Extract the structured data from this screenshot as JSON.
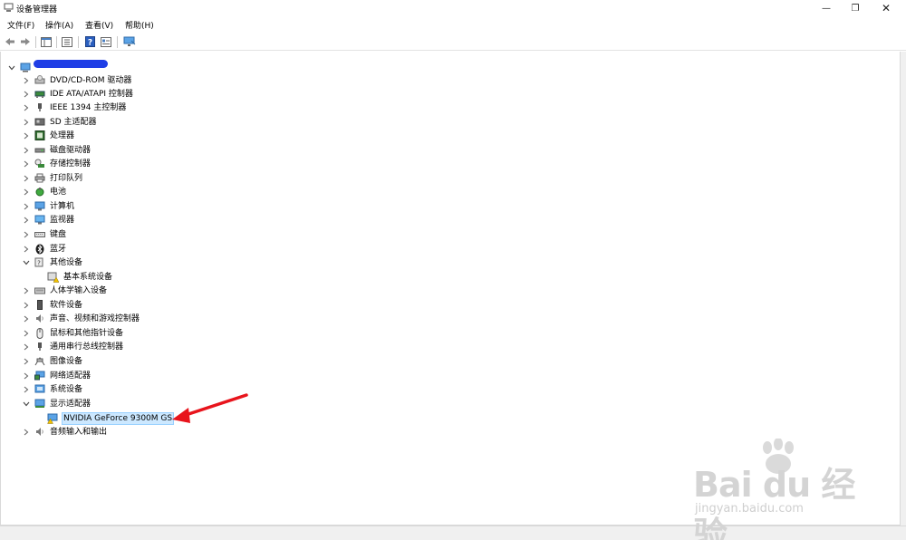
{
  "window": {
    "title": "设备管理器",
    "minimize_glyph": "—",
    "maximize_glyph": "❐",
    "close_glyph": "✕"
  },
  "menu": {
    "items": [
      "文件(F)",
      "操作(A)",
      "查看(V)",
      "帮助(H)"
    ]
  },
  "toolbar": {
    "icons": [
      "back-icon",
      "forward-icon",
      "properties-pane-icon",
      "list-view-icon",
      "help-icon",
      "resources-icon",
      "monitor-icon"
    ]
  },
  "tree": {
    "root_label_redacted": true,
    "nodes": [
      {
        "label": "DVD/CD-ROM 驱动器",
        "icon": "dvd-drive-icon"
      },
      {
        "label": "IDE ATA/ATAPI 控制器",
        "icon": "ide-controller-icon"
      },
      {
        "label": "IEEE 1394 主控制器",
        "icon": "ieee1394-icon"
      },
      {
        "label": "SD 主适配器",
        "icon": "sd-adapter-icon"
      },
      {
        "label": "处理器",
        "icon": "processor-icon"
      },
      {
        "label": "磁盘驱动器",
        "icon": "disk-drive-icon"
      },
      {
        "label": "存储控制器",
        "icon": "storage-controller-icon"
      },
      {
        "label": "打印队列",
        "icon": "printer-icon"
      },
      {
        "label": "电池",
        "icon": "battery-icon"
      },
      {
        "label": "计算机",
        "icon": "computer-icon"
      },
      {
        "label": "监视器",
        "icon": "monitor-icon"
      },
      {
        "label": "键盘",
        "icon": "keyboard-icon"
      },
      {
        "label": "蓝牙",
        "icon": "bluetooth-icon"
      },
      {
        "label": "其他设备",
        "icon": "other-devices-icon",
        "expanded": true
      },
      {
        "label": "基本系统设备",
        "icon": "warning-device-icon",
        "child": true
      },
      {
        "label": "人体学输入设备",
        "icon": "hid-icon"
      },
      {
        "label": "软件设备",
        "icon": "software-device-icon"
      },
      {
        "label": "声音、视频和游戏控制器",
        "icon": "sound-icon"
      },
      {
        "label": "鼠标和其他指针设备",
        "icon": "mouse-icon"
      },
      {
        "label": "通用串行总线控制器",
        "icon": "usb-icon"
      },
      {
        "label": "图像设备",
        "icon": "imaging-icon"
      },
      {
        "label": "网络适配器",
        "icon": "network-adapter-icon"
      },
      {
        "label": "系统设备",
        "icon": "system-device-icon"
      },
      {
        "label": "显示适配器",
        "icon": "display-adapter-icon",
        "expanded": true
      },
      {
        "label": "NVIDIA GeForce 9300M GS",
        "icon": "warning-display-icon",
        "child": true,
        "selected": true
      },
      {
        "label": "音频输入和输出",
        "icon": "audio-io-icon"
      }
    ]
  },
  "annotation": {
    "arrow_color": "#e8141c"
  },
  "watermark": {
    "brand": "Bai du 经验",
    "url": "jingyan.baidu.com"
  }
}
